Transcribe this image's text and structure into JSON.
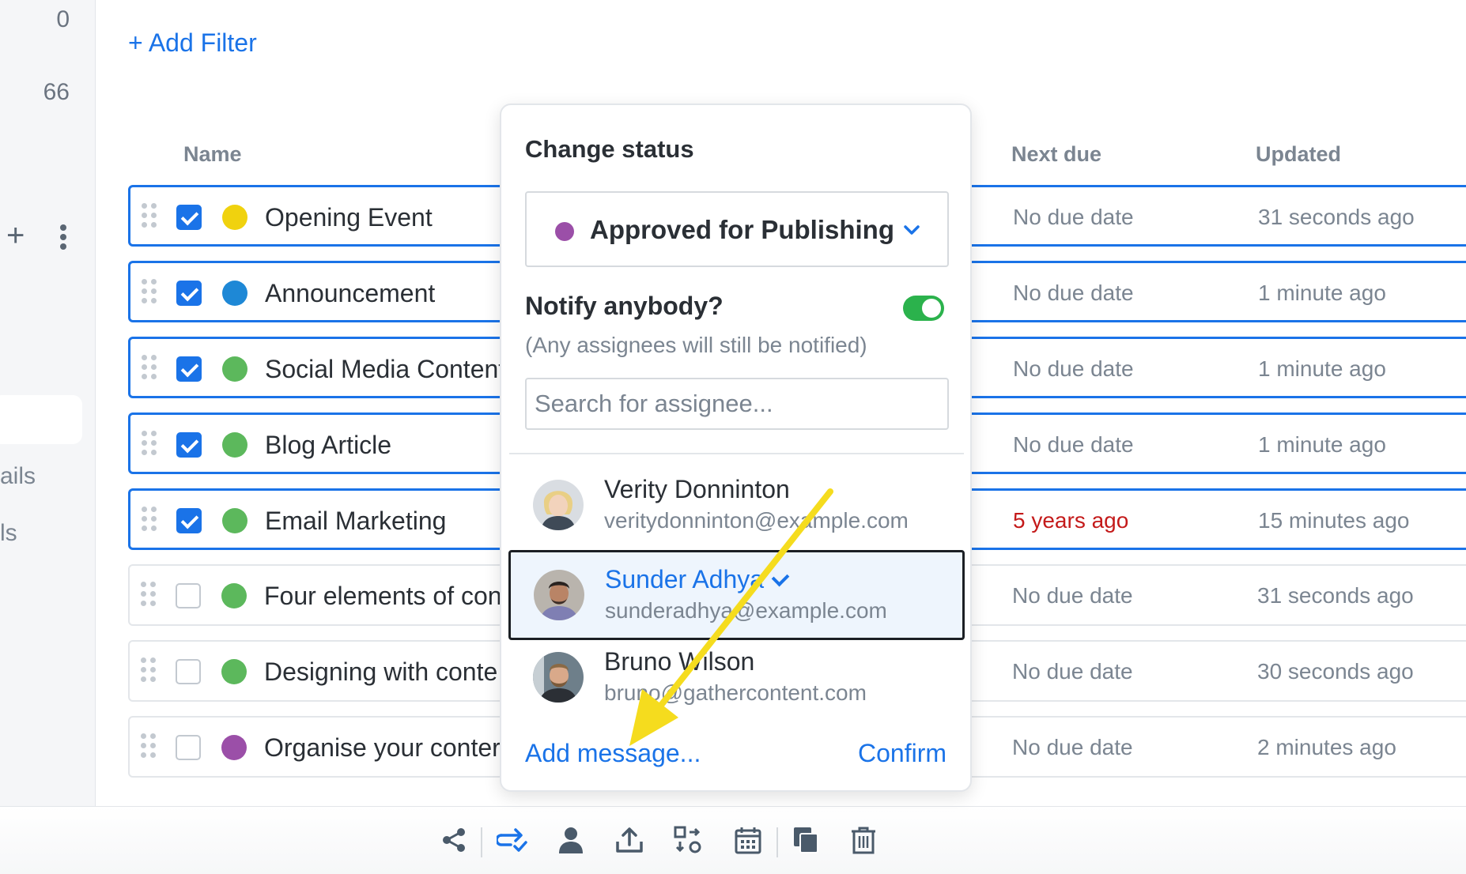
{
  "sidebar": {
    "counts": [
      "0",
      "66"
    ],
    "nav_fragments": [
      "ails",
      "ls"
    ]
  },
  "filters": {
    "add_label": "+ Add Filter"
  },
  "table": {
    "headers": {
      "name": "Name",
      "next_due": "Next due",
      "updated": "Updated"
    },
    "rows": [
      {
        "name": "Opening Event",
        "status_color": "#f0d20e",
        "selected": true,
        "next_due": "No due date",
        "updated": "31 seconds ago"
      },
      {
        "name": "Announcement",
        "status_color": "#1e88d6",
        "selected": true,
        "next_due": "No due date",
        "updated": "1 minute ago"
      },
      {
        "name": "Social Media Content",
        "status_color": "#5cb85c",
        "selected": true,
        "next_due": "No due date",
        "updated": "1 minute ago"
      },
      {
        "name": "Blog Article",
        "status_color": "#5cb85c",
        "selected": true,
        "next_due": "No due date",
        "updated": "1 minute ago"
      },
      {
        "name": "Email Marketing",
        "status_color": "#5cb85c",
        "selected": true,
        "next_due": "5 years ago",
        "updated": "15 minutes ago",
        "overdue": true
      },
      {
        "name": "Four elements of con",
        "status_color": "#5cb85c",
        "selected": false,
        "next_due": "No due date",
        "updated": "31 seconds ago"
      },
      {
        "name": "Designing with conte",
        "status_color": "#5cb85c",
        "selected": false,
        "next_due": "No due date",
        "updated": "30 seconds ago"
      },
      {
        "name": "Organise your conter",
        "status_color": "#9b4fa8",
        "selected": false,
        "next_due": "No due date",
        "updated": "2 minutes ago"
      }
    ]
  },
  "change_status": {
    "title": "Change status",
    "selected_status": {
      "label": "Approved for Publishing",
      "color": "#9b4fa8"
    },
    "notify_label": "Notify anybody?",
    "notify_enabled": true,
    "notify_note": "(Any assignees will still be notified)",
    "search_placeholder": "Search for assignee...",
    "people": [
      {
        "name": "Verity Donninton",
        "email": "veritydonninton@example.com",
        "selected": false
      },
      {
        "name": "Sunder Adhya",
        "email": "sunderadhya@example.com",
        "selected": true
      },
      {
        "name": "Bruno Wilson",
        "email": "bruno@gathercontent.com",
        "selected": false
      }
    ],
    "add_message": "Add message...",
    "confirm": "Confirm"
  },
  "toolbar": {
    "icons": [
      "share-icon",
      "change-status-icon",
      "assign-user-icon",
      "upload-icon",
      "workflow-icon",
      "calendar-icon",
      "duplicate-icon",
      "trash-icon"
    ]
  },
  "colors": {
    "accent": "#1a73e8",
    "overdue": "#c41a1a",
    "toggle_on": "#2bb24c",
    "annotation_arrow": "#f5dc1e"
  }
}
